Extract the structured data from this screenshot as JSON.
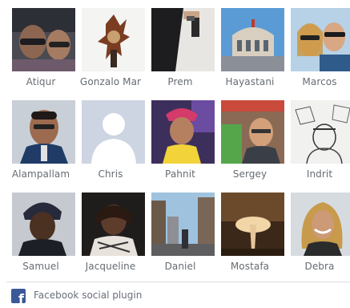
{
  "friends": [
    {
      "name": "Atiqur"
    },
    {
      "name": "Gonzalo Mar"
    },
    {
      "name": "Prem"
    },
    {
      "name": "Hayastani"
    },
    {
      "name": "Marcos"
    },
    {
      "name": "Alampallam"
    },
    {
      "name": "Chris"
    },
    {
      "name": "Pahnit"
    },
    {
      "name": "Sergey"
    },
    {
      "name": "Indrit"
    },
    {
      "name": "Samuel"
    },
    {
      "name": "Jacqueline"
    },
    {
      "name": "Daniel"
    },
    {
      "name": "Mostafa"
    },
    {
      "name": "Debra"
    }
  ],
  "footer": {
    "label": "Facebook social plugin",
    "icon": "facebook-logo-icon",
    "brand_color": "#3b5998"
  }
}
